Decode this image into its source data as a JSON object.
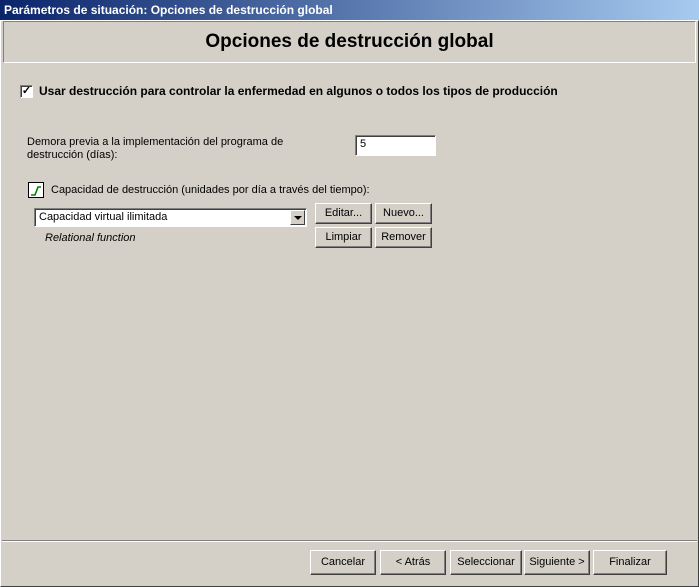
{
  "window": {
    "title": "Parámetros de situación: Opciones de destrucción global"
  },
  "header": {
    "title": "Opciones de destrucción global"
  },
  "main": {
    "use_destruction": {
      "checked": true,
      "label": "Usar destrucción para controlar la enfermedad en algunos o todos los tipos de producción"
    },
    "delay": {
      "label_line1": "Demora previa a la implementación del programa de",
      "label_line2": "destrucción (días):",
      "value": "5"
    },
    "capacity": {
      "label": "Capacidad de destrucción (unidades por día a través del tiempo):",
      "icon": "chart-line-icon",
      "selected": "Capacidad virtual ilimitada",
      "function_type": "Relational function",
      "buttons": {
        "edit": "Editar...",
        "new": "Nuevo...",
        "clear": "Limpiar",
        "remove": "Remover"
      }
    }
  },
  "footer": {
    "cancel": "Cancelar",
    "back": "< Atrás",
    "select": "Seleccionar",
    "next": "Siguiente >",
    "finish": "Finalizar"
  }
}
